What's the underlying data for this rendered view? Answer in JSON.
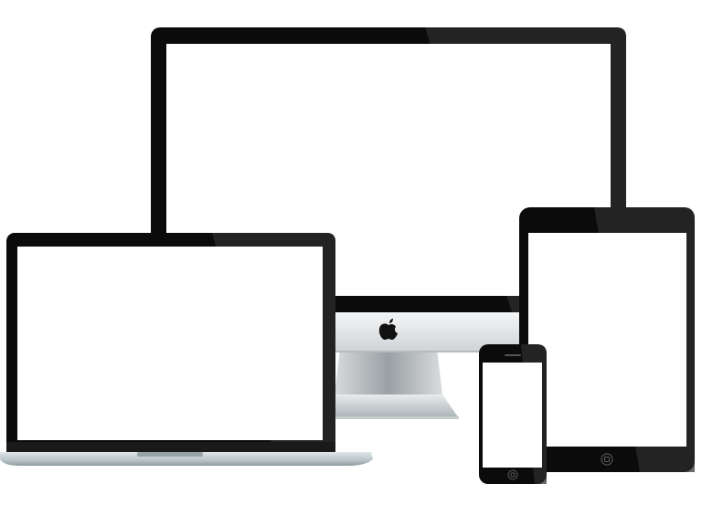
{
  "scene": {
    "description_free": true,
    "devices": [
      "desktop-monitor",
      "laptop",
      "tablet",
      "smartphone"
    ],
    "colors": {
      "bezel": "#0b0b0b",
      "bezel_highlight": "#3a3a3a",
      "screen": "#ffffff",
      "aluminum_light": "#e6e8ea",
      "aluminum_mid": "#c9cdd1",
      "aluminum_dark": "#8f9599",
      "laptop_base": "#b8c4c8"
    },
    "icons": {
      "monitor_logo": "apple-logo-icon",
      "tablet_button": "home-button-icon",
      "phone_button": "home-button-icon"
    }
  }
}
